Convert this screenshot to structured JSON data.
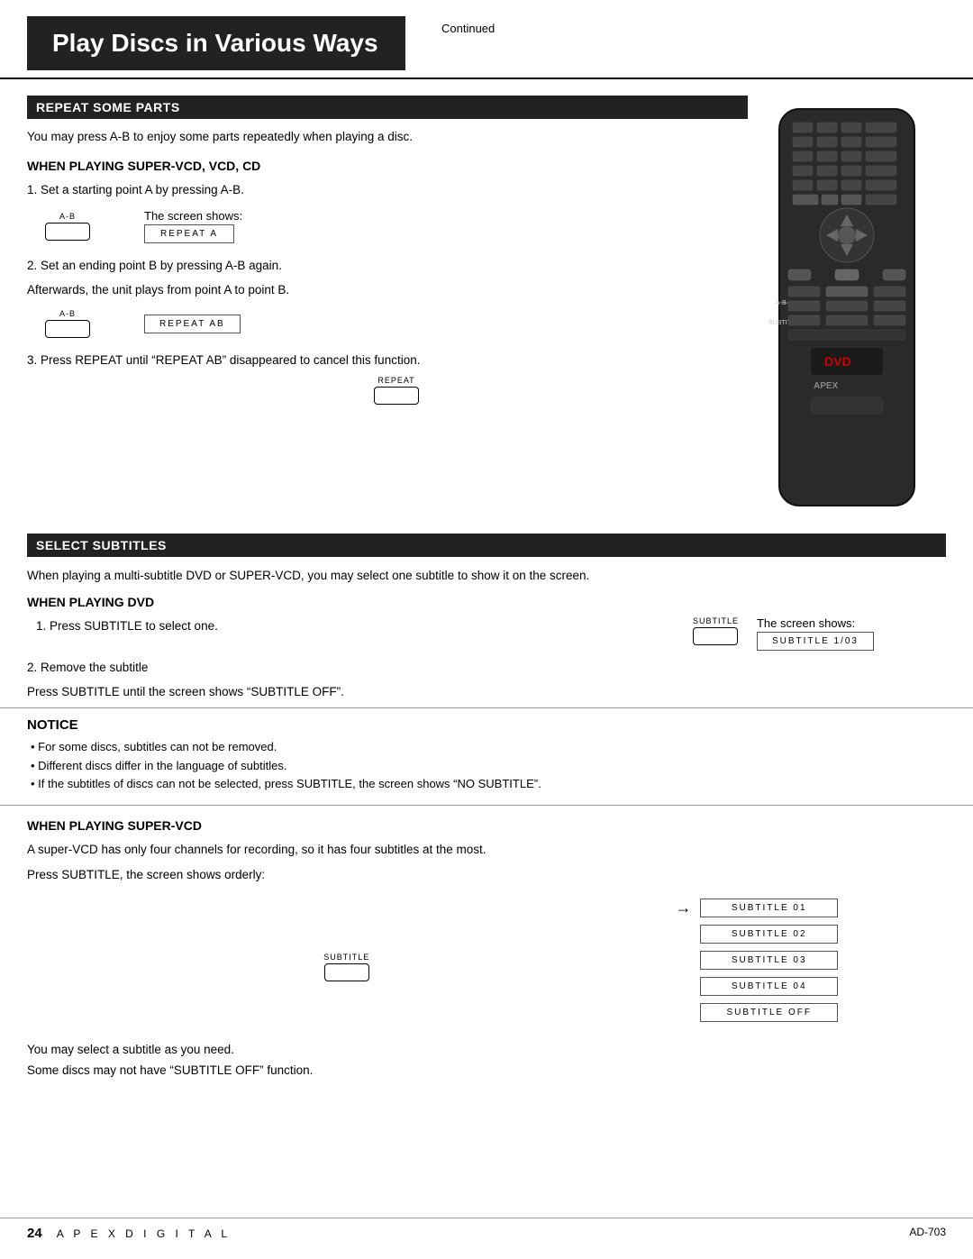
{
  "header": {
    "title": "Play Discs in Various Ways",
    "continued": "Continued"
  },
  "repeat_some_parts": {
    "section_header": "REPEAT SOME PARTS",
    "intro": "You may press A-B to enjoy some parts repeatedly when playing a disc.",
    "subsection_title": "WHEN PLAYING SUPER-VCD, VCD, CD",
    "step1_text": "1. Set a starting point A by pressing A-B.",
    "step1_button_label": "A-B",
    "step1_screen_label": "The screen shows:",
    "step1_screen_text": "REPEAT A",
    "step2_text1": "2. Set an ending point B by pressing A-B again.",
    "step2_text2": "Afterwards, the unit plays from point A to point B.",
    "step2_button_label": "A-B",
    "step2_screen_text": "REPEAT AB",
    "step3_text": "3. Press REPEAT until “REPEAT AB” disappeared to cancel this function.",
    "step3_button_label": "REPEAT"
  },
  "select_subtitles": {
    "section_header": "SELECT SUBTITLES",
    "intro": "When playing a multi-subtitle DVD or SUPER-VCD, you may select one subtitle to show it on the screen.",
    "screen_label": "The screen shows:",
    "subsection_dvd": "WHEN PLAYING DVD",
    "dvd_button_label": "SUBTITLE",
    "dvd_screen_text": "SUBTITLE 1/03",
    "dvd_step1": "1. Press SUBTITLE to select one.",
    "dvd_step2": "2. Remove the subtitle",
    "dvd_step2b": "Press SUBTITLE until the screen shows “SUBTITLE OFF”."
  },
  "notice": {
    "title": "NOTICE",
    "items": [
      "For some discs, subtitles can not be removed.",
      "Different discs differ in the language of subtitles.",
      "If the subtitles of discs can not be selected, press SUBTITLE, the screen shows “NO SUBTITLE”."
    ]
  },
  "when_playing_super_vcd": {
    "title": "WHEN PLAYING SUPER-VCD",
    "text1": "A super-VCD has only four channels for recording, so it has four subtitles at the most.",
    "text2": "Press SUBTITLE, the screen shows orderly:",
    "button_label": "SUBTITLE",
    "screens": [
      "SUBTITLE 01",
      "SUBTITLE 02",
      "SUBTITLE 03",
      "SUBTITLE 04",
      "SUBTITLE OFF"
    ],
    "bottom_text1": "You may select a subtitle as you need.",
    "bottom_text2": "Some discs may not have “SUBTITLE OFF” function."
  },
  "footer": {
    "page_number": "24",
    "brand": "A P E X   D I G I T A L",
    "model": "AD-703"
  }
}
